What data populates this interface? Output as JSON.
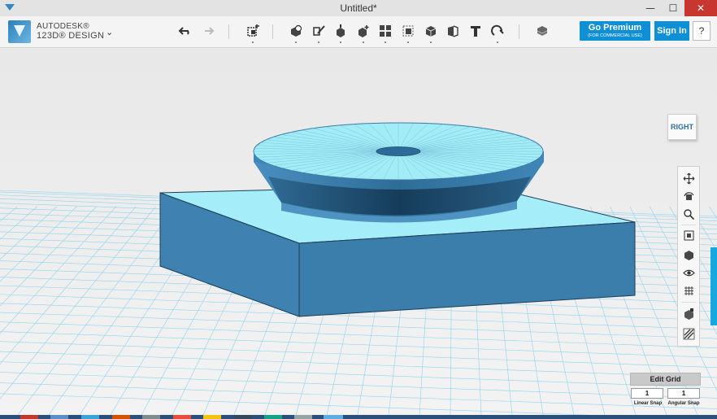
{
  "window": {
    "title": "Untitled*",
    "controls": [
      "minimize",
      "maximize",
      "close"
    ]
  },
  "app": {
    "brand_line1": "AUTODESK®",
    "brand_line2": "123D® DESIGN",
    "menu_chevron": "⌄"
  },
  "toolbar": {
    "tools": [
      {
        "name": "undo-icon"
      },
      {
        "name": "redo-icon"
      },
      {
        "name": "transform-icon"
      },
      {
        "name": "primitives-icon"
      },
      {
        "name": "sketch-icon"
      },
      {
        "name": "construct-icon"
      },
      {
        "name": "modify-icon"
      },
      {
        "name": "pattern-icon"
      },
      {
        "name": "grouping-icon"
      },
      {
        "name": "combine-icon"
      },
      {
        "name": "measure-icon"
      },
      {
        "name": "text-icon"
      },
      {
        "name": "snap-icon"
      },
      {
        "name": "material-icon"
      }
    ],
    "premium_label": "Go Premium",
    "premium_sublabel": "(FOR COMMERCIAL USE)",
    "signin_label": "Sign In",
    "help_label": "?"
  },
  "viewcube": {
    "face_label": "RIGHT"
  },
  "navbar": {
    "items": [
      {
        "name": "pan-icon"
      },
      {
        "name": "orbit-icon"
      },
      {
        "name": "zoom-icon"
      },
      {
        "name": "fit-icon"
      },
      {
        "name": "view-mode-icon"
      },
      {
        "name": "visibility-icon"
      },
      {
        "name": "grid-icon"
      },
      {
        "name": "materials-display-icon"
      },
      {
        "name": "perspective-icon"
      }
    ]
  },
  "edit_grid": {
    "button_label": "Edit Grid",
    "linear_snap_value": "1",
    "angular_snap_value": "1",
    "linear_snap_label": "Linear Snap",
    "angular_snap_label": "Angular Snap"
  },
  "colors": {
    "accent": "#0f8fd6",
    "model_top": "#a4eef9",
    "model_side": "#3d7fae",
    "grid_line": "#8fd3ef",
    "viewport_bg": "#e9e9e9"
  }
}
